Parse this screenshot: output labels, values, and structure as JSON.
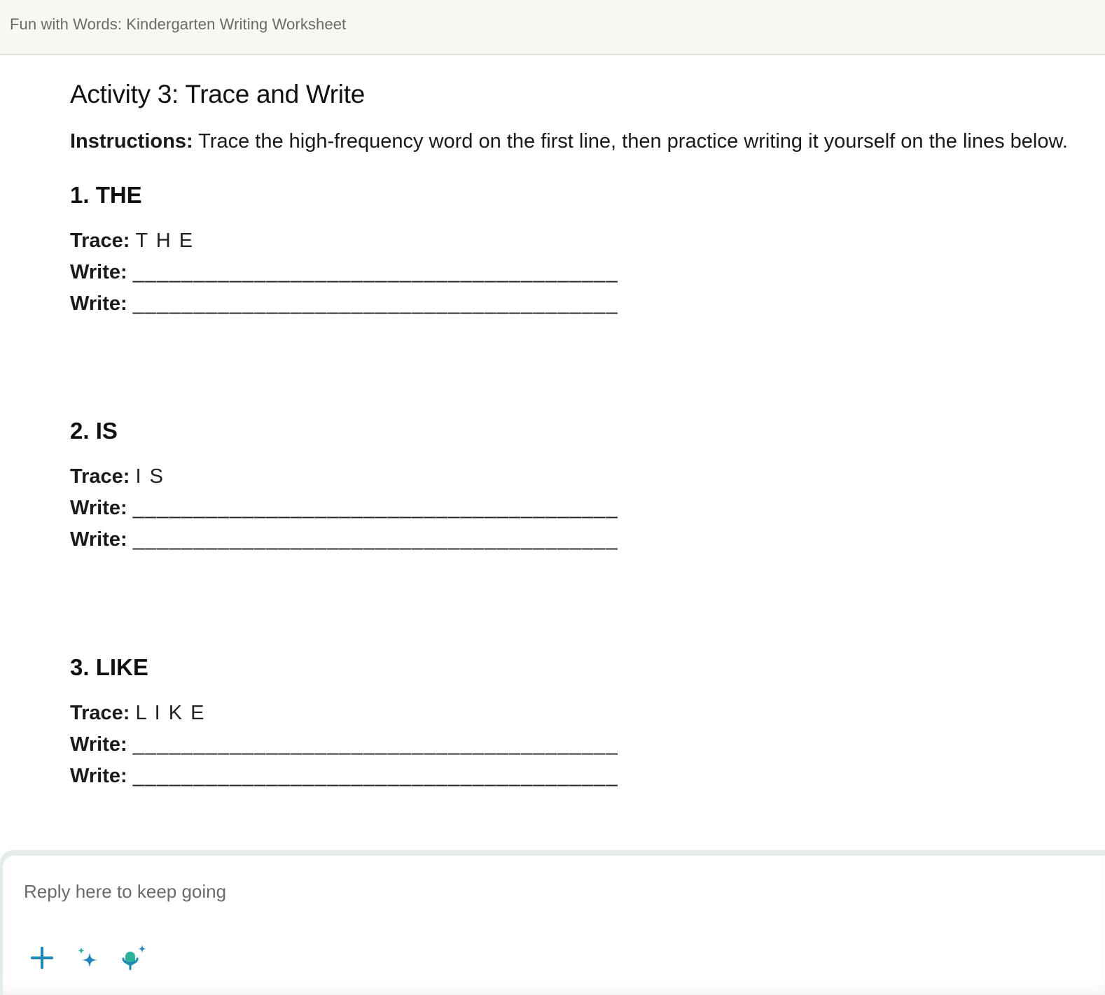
{
  "header": {
    "title": "Fun with Words: Kindergarten Writing Worksheet"
  },
  "activity": {
    "title": "Activity 3: Trace and Write",
    "instructions_label": "Instructions:",
    "instructions_text": " Trace the high-frequency word on the first line, then practice writing it yourself on the lines below."
  },
  "words": [
    {
      "heading": "1. THE",
      "trace_label": "Trace:",
      "trace_value": "T H E",
      "write_label": "Write:",
      "blank": "________________________________________"
    },
    {
      "heading": "2. IS",
      "trace_label": "Trace:",
      "trace_value": "I S",
      "write_label": "Write:",
      "blank": "________________________________________"
    },
    {
      "heading": "3. LIKE",
      "trace_label": "Trace:",
      "trace_value": "L I K E",
      "write_label": "Write:",
      "blank": "________________________________________"
    }
  ],
  "composer": {
    "placeholder": "Reply here to keep going",
    "icons": {
      "add": "plus-icon",
      "ai": "sparkle-icon",
      "voice": "microphone-sparkle-icon"
    },
    "colors": {
      "blue": "#1f87b5",
      "teal": "#2bb39a"
    }
  }
}
